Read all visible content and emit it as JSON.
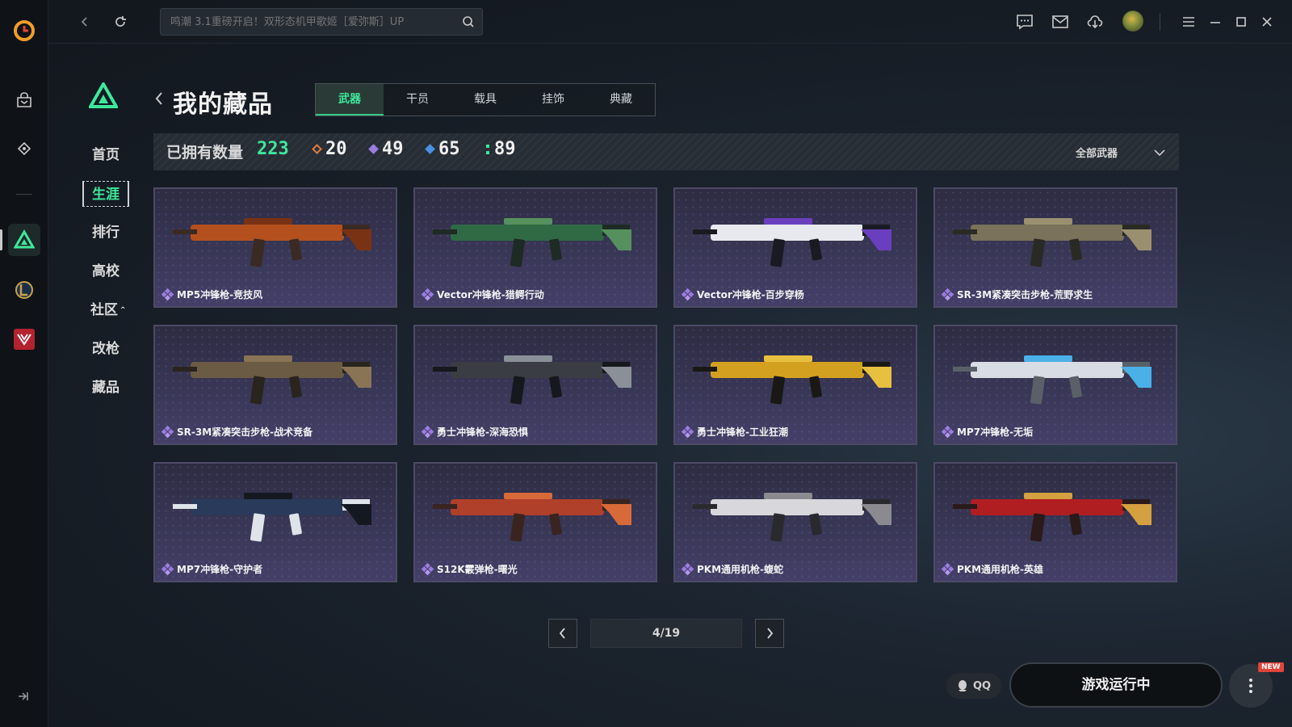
{
  "topbar": {
    "search_placeholder": "鸣潮 3.1重磅开启！双形态机甲歌姬［爱弥斯］UP"
  },
  "nav": {
    "items": [
      {
        "label": "首页"
      },
      {
        "label": "生涯"
      },
      {
        "label": "排行"
      },
      {
        "label": "高校"
      },
      {
        "label": "社区"
      },
      {
        "label": "改枪"
      },
      {
        "label": "藏品"
      }
    ],
    "active": "生涯"
  },
  "page": {
    "title": "我的藏品",
    "tabs": [
      {
        "label": "武器"
      },
      {
        "label": "干员"
      },
      {
        "label": "载具"
      },
      {
        "label": "挂饰"
      },
      {
        "label": "典藏"
      }
    ],
    "active_tab": "武器"
  },
  "stats": {
    "label": "已拥有数量",
    "total": "223",
    "counts": [
      {
        "value": "20",
        "color": "#e07a3e"
      },
      {
        "value": "49",
        "color": "#9a7ce0"
      },
      {
        "value": "65",
        "color": "#4a8fe0"
      },
      {
        "value": "89",
        "color": "#3ee89c"
      }
    ],
    "filter_label": "全部武器"
  },
  "items": [
    {
      "name": "MP5冲锋枪-竞技风",
      "gun_colors": [
        "#b4501e",
        "#3a2a24",
        "#7a3214"
      ]
    },
    {
      "name": "Vector冲锋枪-猎鳄行动",
      "gun_colors": [
        "#2f6a45",
        "#1e2a24",
        "#56905e"
      ]
    },
    {
      "name": "Vector冲锋枪-百步穿杨",
      "gun_colors": [
        "#e8e8ef",
        "#1a1a22",
        "#6a3fbf"
      ]
    },
    {
      "name": "SR-3M紧凑突击步枪-荒野求生",
      "gun_colors": [
        "#7a725a",
        "#2a2a24",
        "#9a9070"
      ]
    },
    {
      "name": "SR-3M紧凑突击步枪-战术竞备",
      "gun_colors": [
        "#6b5a44",
        "#2a241e",
        "#8a7456"
      ]
    },
    {
      "name": "勇士冲锋枪-深海恐惧",
      "gun_colors": [
        "#3a3e44",
        "#15181c",
        "#8a9098"
      ]
    },
    {
      "name": "勇士冲锋枪-工业狂潮",
      "gun_colors": [
        "#d4a020",
        "#1a1814",
        "#e8c040"
      ]
    },
    {
      "name": "MP7冲锋枪-无垢",
      "gun_colors": [
        "#d8dce4",
        "#5a6068",
        "#4ab0e8"
      ]
    },
    {
      "name": "MP7冲锋枪-守护者",
      "gun_colors": [
        "#2a3a5a",
        "#dfe3ea",
        "#141820"
      ]
    },
    {
      "name": "S12K霰弹枪-曙光",
      "gun_colors": [
        "#b0402a",
        "#3a2420",
        "#d86a3a"
      ]
    },
    {
      "name": "PKM通用机枪-蝮蛇",
      "gun_colors": [
        "#d8d8dc",
        "#2a2a2e",
        "#8a8a90"
      ]
    },
    {
      "name": "PKM通用机枪-英雄",
      "gun_colors": [
        "#b01e22",
        "#2a1a1a",
        "#d4a040"
      ]
    }
  ],
  "pagination": {
    "current": "4/19"
  },
  "footer": {
    "qq_label": "QQ",
    "game_status": "游戏运行中",
    "new_badge": "NEW"
  }
}
